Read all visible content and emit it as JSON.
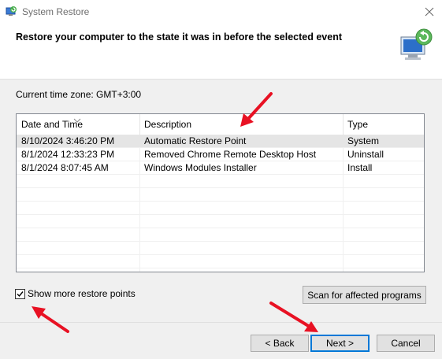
{
  "window": {
    "title": "System Restore",
    "icon": "system-restore-icon",
    "close_icon": "close-icon"
  },
  "header": {
    "title": "Restore your computer to the state it was in before the selected event",
    "graphic": "restore-computer-graphic"
  },
  "timezone_label": "Current time zone: GMT+3:00",
  "table": {
    "columns": [
      "Date and Time",
      "Description",
      "Type"
    ],
    "sort_column": "Date and Time",
    "rows": [
      {
        "date": "8/10/2024 3:46:20 PM",
        "description": "Automatic Restore Point",
        "type": "System",
        "selected": true
      },
      {
        "date": "8/1/2024 12:33:23 PM",
        "description": "Removed Chrome Remote Desktop Host",
        "type": "Uninstall",
        "selected": false
      },
      {
        "date": "8/1/2024 8:07:45 AM",
        "description": "Windows Modules Installer",
        "type": "Install",
        "selected": false
      }
    ]
  },
  "show_more": {
    "label": "Show more restore points",
    "checked": true
  },
  "buttons": {
    "scan": "Scan for affected programs",
    "back": "< Back",
    "next": "Next >",
    "cancel": "Cancel"
  },
  "colors": {
    "accent": "#0078d7",
    "annotation_arrow": "#e81123"
  }
}
